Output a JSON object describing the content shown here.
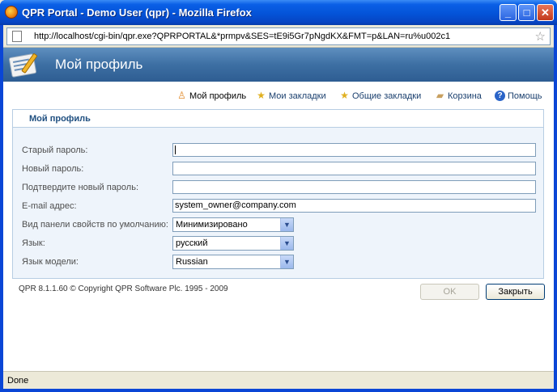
{
  "window": {
    "title": "QPR Portal - Demo User (qpr) - Mozilla Firefox",
    "min_label": "_",
    "max_label": "□",
    "close_label": "✕"
  },
  "browser": {
    "url": "http://localhost/cgi-bin/qpr.exe?QPRPORTAL&*prmpv&SES=tE9i5Gr7pNgdKX&FMT=p&LAN=ru%u002c1",
    "status": "Done"
  },
  "header": {
    "title": "Мой профиль"
  },
  "nav": {
    "items": [
      {
        "label": "Мой профиль",
        "icon": "person-icon"
      },
      {
        "label": "Мои закладки",
        "icon": "bookmark-star-icon"
      },
      {
        "label": "Общие закладки",
        "icon": "shared-bookmarks-icon"
      },
      {
        "label": "Корзина",
        "icon": "basket-icon"
      },
      {
        "label": "Помощь",
        "icon": "help-icon"
      }
    ]
  },
  "panel": {
    "title": "Мой профиль",
    "fields": {
      "old_password_label": "Старый пароль:",
      "new_password_label": "Новый пароль:",
      "confirm_password_label": "Подтвердите новый пароль:",
      "email_label": "E-mail адрес:",
      "email_value": "system_owner@company.com",
      "panel_default_label": "Вид панели свойств по умолчанию:",
      "panel_default_value": "Минимизировано",
      "language_label": "Язык:",
      "language_value": "русский",
      "model_language_label": "Язык модели:",
      "model_language_value": "Russian"
    }
  },
  "footer": {
    "copyright": "QPR 8.1.1.60 © Copyright QPR Software Plc. 1995 - 2009",
    "ok_label": "OK",
    "close_label": "Закрыть"
  },
  "colors": {
    "titlebar": "#0453d8",
    "header": "#3d6fa3",
    "panel_bg": "#eef4fb",
    "panel_border": "#b7cde3"
  }
}
